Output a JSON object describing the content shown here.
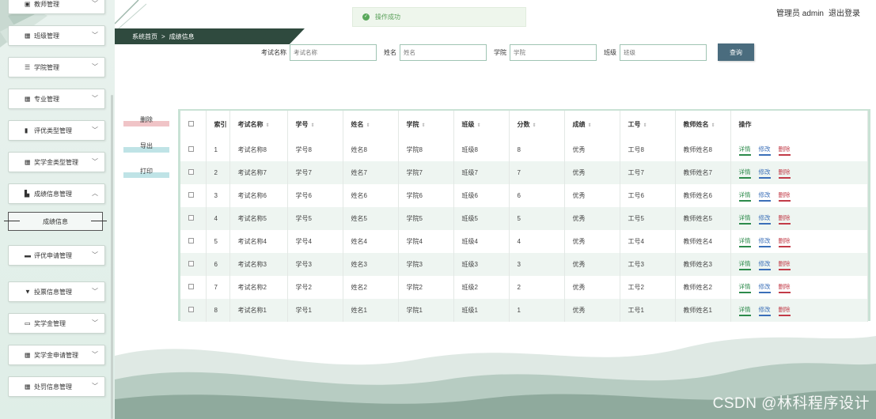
{
  "sidebar": {
    "items": [
      {
        "label": "教师管理",
        "icon": "user-card-icon",
        "chevron": "﹀"
      },
      {
        "label": "班级管理",
        "icon": "grid-icon",
        "chevron": "﹀"
      },
      {
        "label": "学院管理",
        "icon": "list-icon",
        "chevron": "﹀"
      },
      {
        "label": "专业管理",
        "icon": "grid-icon",
        "chevron": "﹀"
      },
      {
        "label": "评优类型管理",
        "icon": "bar-chart-icon",
        "chevron": "﹀"
      },
      {
        "label": "奖学金类型管理",
        "icon": "grid-icon",
        "chevron": "﹀"
      },
      {
        "label": "成绩信息管理",
        "icon": "stats-icon",
        "chevron": "︿"
      },
      {
        "label": "评优申请管理",
        "icon": "message-icon",
        "chevron": "﹀"
      },
      {
        "label": "投票信息管理",
        "icon": "vote-icon",
        "chevron": "﹀"
      },
      {
        "label": "奖学金管理",
        "icon": "briefcase-icon",
        "chevron": "﹀"
      },
      {
        "label": "奖学金申请管理",
        "icon": "grid-icon",
        "chevron": "﹀"
      },
      {
        "label": "处罚信息管理",
        "icon": "grid-icon",
        "chevron": "﹀"
      }
    ],
    "active_sub": "成绩信息"
  },
  "toast": {
    "text": "操作成功"
  },
  "user": {
    "role": "管理员 admin",
    "logout": "退出登录"
  },
  "breadcrumb": {
    "home": "系统首页",
    "separator": ">",
    "current": "成绩信息"
  },
  "search": {
    "fields": [
      {
        "label": "考试名称",
        "placeholder": "考试名称"
      },
      {
        "label": "姓名",
        "placeholder": "姓名"
      },
      {
        "label": "学院",
        "placeholder": "学院"
      },
      {
        "label": "班级",
        "placeholder": "班级"
      }
    ],
    "button": "查询"
  },
  "actions": {
    "delete": "删除",
    "export": "导出",
    "print": "打印"
  },
  "table": {
    "headers": [
      "索引",
      "考试名称",
      "学号",
      "姓名",
      "学院",
      "班级",
      "分数",
      "成绩",
      "工号",
      "教师姓名",
      "操作"
    ],
    "sort_glyph": "⇕",
    "op_labels": {
      "detail": "详情",
      "edit": "修改",
      "delete": "删除"
    },
    "rows": [
      {
        "index": "1",
        "exam": "考试名称8",
        "sid": "学号8",
        "name": "姓名8",
        "college": "学院8",
        "class": "班级8",
        "score": "8",
        "grade": "优秀",
        "tid": "工号8",
        "teacher": "教师姓名8"
      },
      {
        "index": "2",
        "exam": "考试名称7",
        "sid": "学号7",
        "name": "姓名7",
        "college": "学院7",
        "class": "班级7",
        "score": "7",
        "grade": "优秀",
        "tid": "工号7",
        "teacher": "教师姓名7"
      },
      {
        "index": "3",
        "exam": "考试名称6",
        "sid": "学号6",
        "name": "姓名6",
        "college": "学院6",
        "class": "班级6",
        "score": "6",
        "grade": "优秀",
        "tid": "工号6",
        "teacher": "教师姓名6"
      },
      {
        "index": "4",
        "exam": "考试名称5",
        "sid": "学号5",
        "name": "姓名5",
        "college": "学院5",
        "class": "班级5",
        "score": "5",
        "grade": "优秀",
        "tid": "工号5",
        "teacher": "教师姓名5"
      },
      {
        "index": "5",
        "exam": "考试名称4",
        "sid": "学号4",
        "name": "姓名4",
        "college": "学院4",
        "class": "班级4",
        "score": "4",
        "grade": "优秀",
        "tid": "工号4",
        "teacher": "教师姓名4"
      },
      {
        "index": "6",
        "exam": "考试名称3",
        "sid": "学号3",
        "name": "姓名3",
        "college": "学院3",
        "class": "班级3",
        "score": "3",
        "grade": "优秀",
        "tid": "工号3",
        "teacher": "教师姓名3"
      },
      {
        "index": "7",
        "exam": "考试名称2",
        "sid": "学号2",
        "name": "姓名2",
        "college": "学院2",
        "class": "班级2",
        "score": "2",
        "grade": "优秀",
        "tid": "工号2",
        "teacher": "教师姓名2"
      },
      {
        "index": "8",
        "exam": "考试名称1",
        "sid": "学号1",
        "name": "姓名1",
        "college": "学院1",
        "class": "班级1",
        "score": "1",
        "grade": "优秀",
        "tid": "工号1",
        "teacher": "教师姓名1"
      }
    ]
  },
  "watermark": "CSDN @林科程序设计",
  "colors": {
    "accent_dark": "#2f4a3e",
    "table_border": "#c9e2d5",
    "search_button": "#4a6c7e",
    "delete_red": "#c23b48",
    "edit_blue": "#3b6fb8",
    "detail_green": "#2c8a4b",
    "success": "#58a85a"
  }
}
